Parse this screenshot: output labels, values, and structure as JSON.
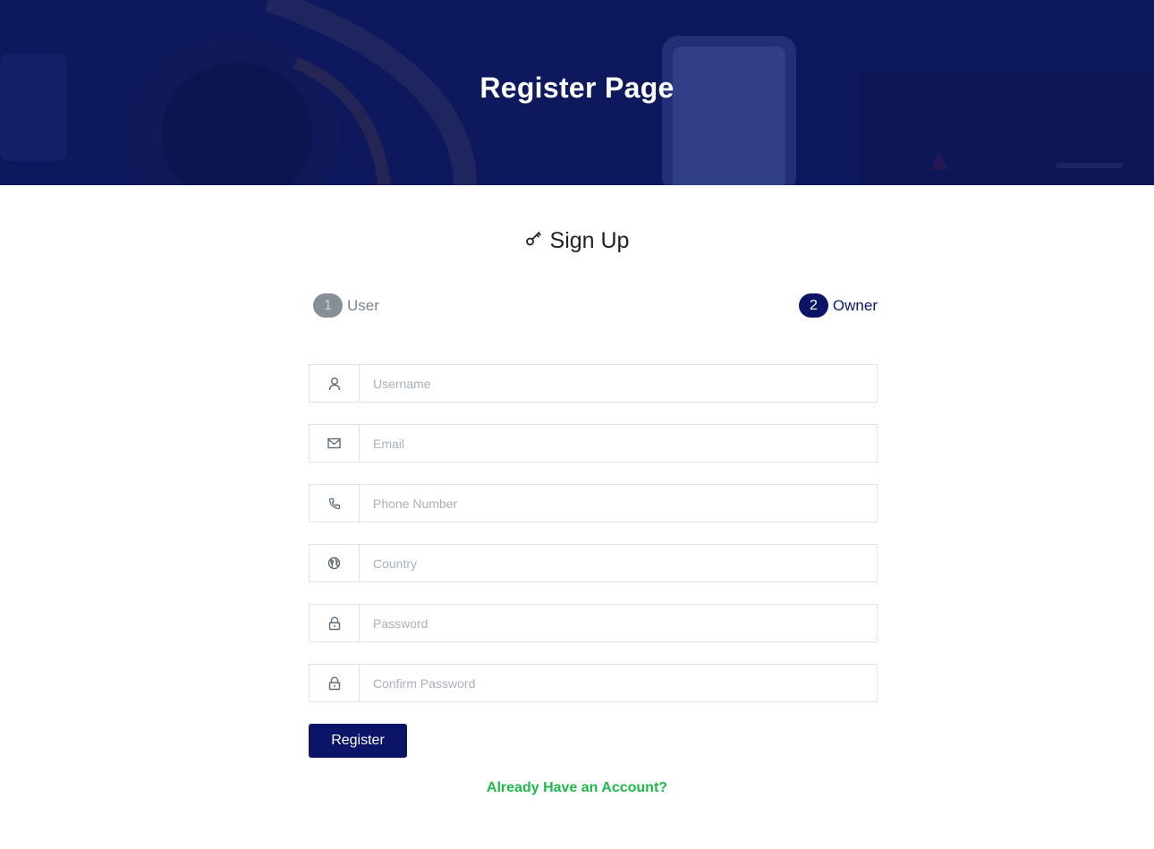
{
  "hero": {
    "title": "Register Page"
  },
  "form": {
    "heading": "Sign Up",
    "heading_icon": "key-icon",
    "steps": [
      {
        "number": "1",
        "label": "User",
        "active": false
      },
      {
        "number": "2",
        "label": "Owner",
        "active": true
      }
    ],
    "fields": [
      {
        "icon": "user-icon",
        "placeholder": "Username",
        "value": ""
      },
      {
        "icon": "mail-icon",
        "placeholder": "Email",
        "value": ""
      },
      {
        "icon": "phone-icon",
        "placeholder": "Phone Number",
        "value": ""
      },
      {
        "icon": "globe-icon",
        "placeholder": "Country",
        "value": ""
      },
      {
        "icon": "lock-icon",
        "placeholder": "Password",
        "value": ""
      },
      {
        "icon": "lock-icon",
        "placeholder": "Confirm Password",
        "value": ""
      }
    ],
    "submit_label": "Register",
    "login_link_label": "Already Have an Account?"
  },
  "colors": {
    "primary": "#0b1466",
    "link": "#1fb94a",
    "step_inactive": "#868e96"
  }
}
